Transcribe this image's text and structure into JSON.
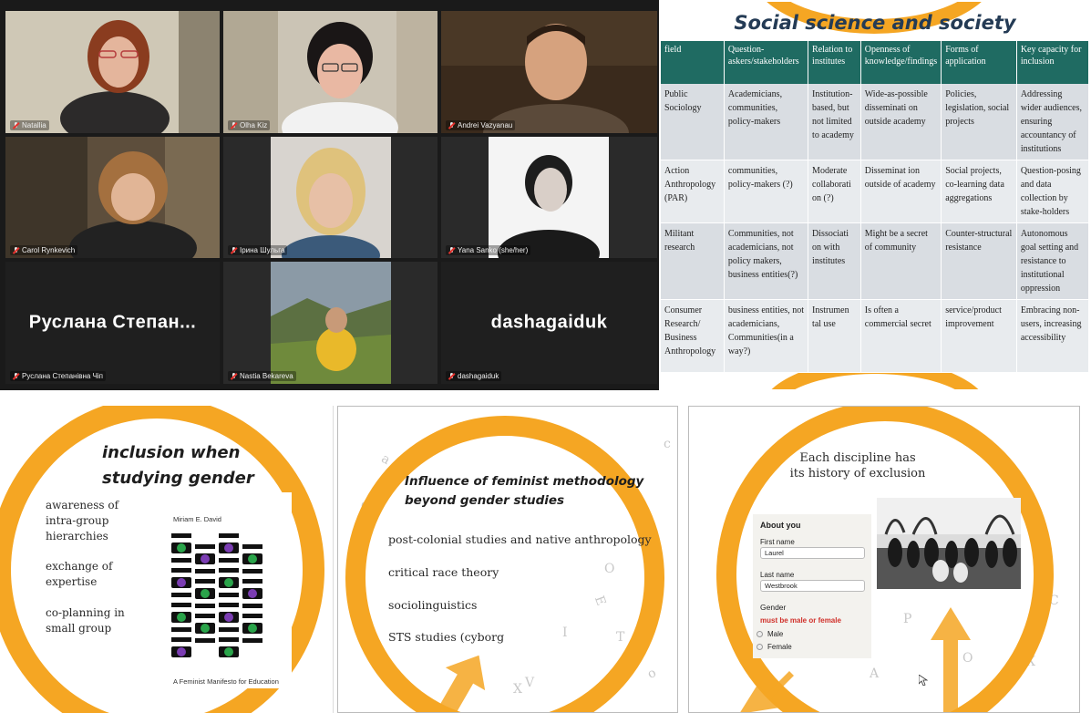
{
  "participants": [
    {
      "name": "Natallia",
      "display": "video",
      "active": false
    },
    {
      "name": "Olha Kiz",
      "display": "video",
      "active": false
    },
    {
      "name": "Andrei Vazyanau",
      "display": "video",
      "active": true
    },
    {
      "name": "Carol Rynkevich",
      "display": "video",
      "active": false
    },
    {
      "name": "Ірина Шульга",
      "display": "video",
      "active": false
    },
    {
      "name": "Yana Sanko (she/her)",
      "display": "video",
      "active": false
    },
    {
      "name": "Руслана Степанівна Чіп",
      "display": "name",
      "big_text": "Руслана  Степан...",
      "active": false
    },
    {
      "name": "Nastia Bekareva",
      "display": "video",
      "active": false
    },
    {
      "name": "dashagaiduk",
      "display": "name",
      "big_text": "dashagaiduk",
      "active": false
    }
  ],
  "social_slide": {
    "title": "Social science and society",
    "headers": [
      "field",
      "Question-askers/stakeholders",
      "Relation to institutes",
      "Openness of knowledge/findings",
      "Forms of application",
      "Key capacity for inclusion"
    ],
    "rows": [
      [
        "Public Sociology",
        "Academicians, communities, policy-makers",
        "Institution-based, but not limited to academy",
        "Wide-as-possible disseminati on outside academy",
        "Policies, legislation, social projects",
        "Addressing wider audiences, ensuring accountancy of institutions"
      ],
      [
        "Action Anthropology (PAR)",
        "communities, policy-makers (?)",
        "Moderate collaborati on (?)",
        "Disseminat ion outside of academy",
        "Social projects, co-learning data aggregations",
        "Question-posing and data collection by stake-holders"
      ],
      [
        "Militant research",
        "Communities, not academicians, not policy makers, business entities(?)",
        "Dissociati on with institutes",
        "Might be a secret of community",
        "Counter-structural resistance",
        "Autonomous goal setting and resistance to institutional oppression"
      ],
      [
        "Consumer Research/ Business Anthropology",
        "business entities, not academicians, Communities(in a way?)",
        "Instrumen tal use",
        "Is often a commercial secret",
        "service/product improvement",
        "Embracing non-users, increasing accessibility"
      ]
    ]
  },
  "slide_gender": {
    "title_line1": "inclusion when",
    "title_line2": "studying gender",
    "items": [
      "awareness of intra-group hierarchies",
      "exchange of expertise",
      "co-planning in small group"
    ],
    "book_author": "Miriam E. David",
    "book_subtitle": "A Feminist Manifesto for Education"
  },
  "slide_feminist": {
    "title_line1": "Influence of feminist methodology",
    "title_line2": "beyond gender studies",
    "items": [
      "post-colonial studies and native anthropology",
      "critical race theory",
      "sociolinguistics",
      "STS studies (cyborg"
    ]
  },
  "slide_discipline": {
    "title_line1": "Each discipline has",
    "title_line2": "its history of exclusion",
    "form": {
      "heading": "About you",
      "first_name_label": "First name",
      "first_name_value": "Laurel",
      "last_name_label": "Last name",
      "last_name_value": "Westbrook",
      "gender_label": "Gender",
      "error": "must be male or female",
      "options": [
        "Male",
        "Female"
      ]
    }
  },
  "colors": {
    "accent_orange": "#f5a623",
    "table_header": "#1f6b62",
    "active_border": "#c6d84a"
  }
}
